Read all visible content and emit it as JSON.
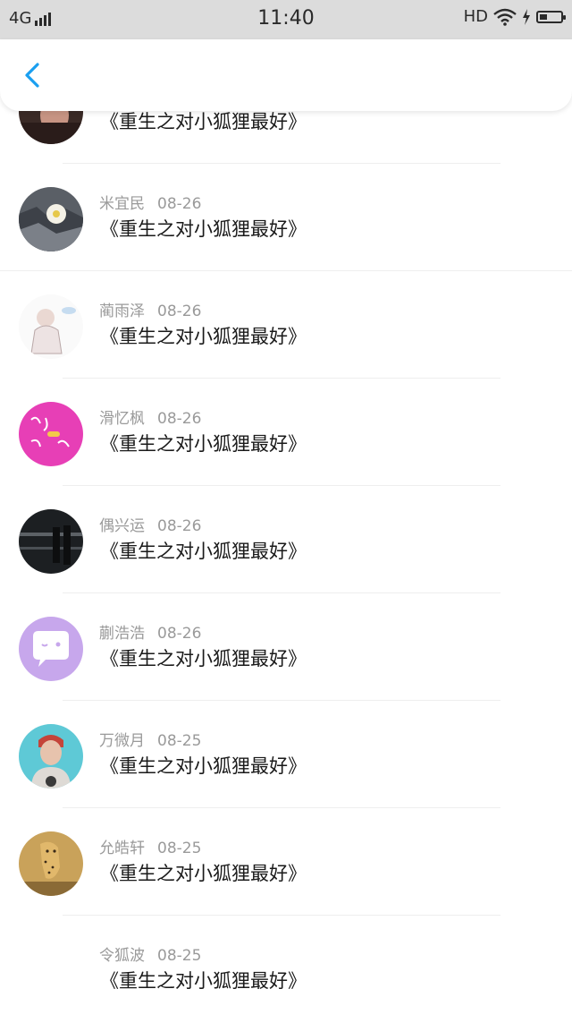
{
  "status_bar": {
    "network": "4G",
    "time": "11:40",
    "hd": "HD",
    "icons": [
      "signal-icon",
      "wifi-icon",
      "charging-icon",
      "battery-icon"
    ],
    "battery_level": 0.35
  },
  "nav": {
    "back_icon": "chevron-left-icon",
    "accent_color": "#1a9ff0"
  },
  "messages": [
    {
      "name": "",
      "date": "",
      "text": "《重生之对小狐狸最好》",
      "avatar": "avatar-photo-dark"
    },
    {
      "name": "米宜民",
      "date": "08-26",
      "text": "《重生之对小狐狸最好》",
      "avatar": "avatar-flower"
    },
    {
      "name": "蔺雨泽",
      "date": "08-26",
      "text": "《重生之对小狐狸最好》",
      "avatar": "avatar-sketch"
    },
    {
      "name": "滑忆枫",
      "date": "08-26",
      "text": "《重生之对小狐狸最好》",
      "avatar": "avatar-pink-text"
    },
    {
      "name": "偶兴运",
      "date": "08-26",
      "text": "《重生之对小狐狸最好》",
      "avatar": "avatar-night-photo"
    },
    {
      "name": "蒯浩浩",
      "date": "08-26",
      "text": "《重生之对小狐狸最好》",
      "avatar": "avatar-purple-chat"
    },
    {
      "name": "万微月",
      "date": "08-25",
      "text": "《重生之对小狐狸最好》",
      "avatar": "avatar-person"
    },
    {
      "name": "允皓轩",
      "date": "08-25",
      "text": "《重生之对小狐狸最好》",
      "avatar": "avatar-cheetah"
    },
    {
      "name": "令狐波",
      "date": "08-25",
      "text": "《重生之对小狐狸最好》",
      "avatar": "avatar-none"
    }
  ]
}
